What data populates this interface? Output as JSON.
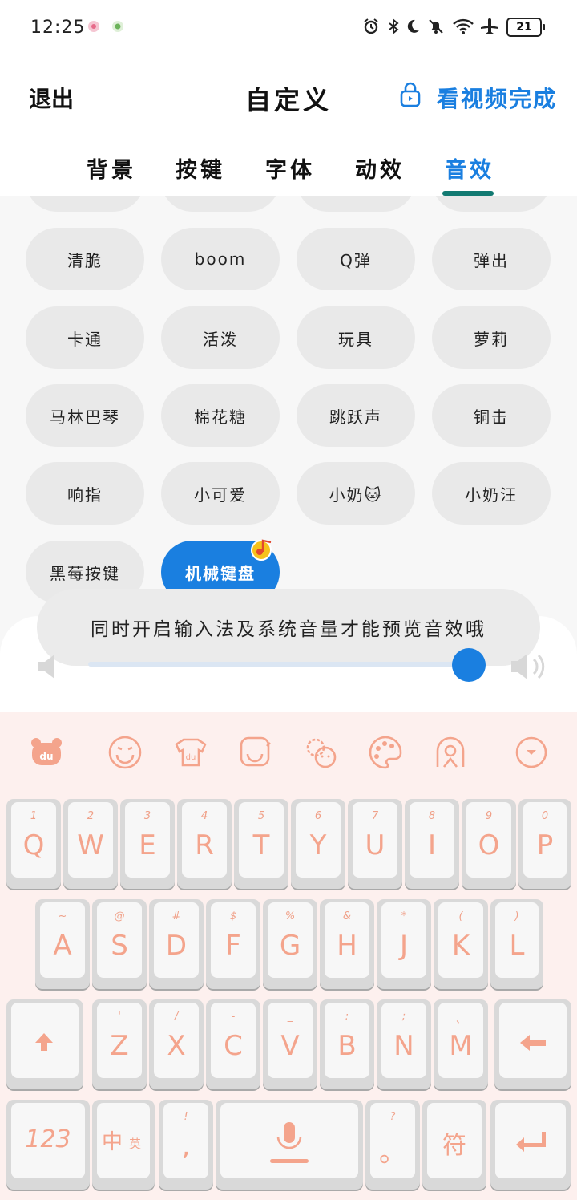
{
  "status_bar": {
    "time": "12:25",
    "battery": "21",
    "icons": [
      "notification-app-icon",
      "wechat-icon",
      "alarm-icon",
      "bluetooth-icon",
      "moon-icon",
      "mute-bell-icon",
      "wifi-icon",
      "airplane-icon"
    ]
  },
  "header": {
    "exit_label": "退出",
    "title": "自定义",
    "action_label": "看视频完成",
    "action_icon": "lock-icon",
    "accent_color": "#1a7fe0"
  },
  "tabs": [
    {
      "label": "背景",
      "active": false
    },
    {
      "label": "按键",
      "active": false
    },
    {
      "label": "字体",
      "active": false
    },
    {
      "label": "动效",
      "active": false
    },
    {
      "label": "音效",
      "active": true
    }
  ],
  "sound_effects": [
    {
      "label": "清脆"
    },
    {
      "label": "boom"
    },
    {
      "label": "Q弹"
    },
    {
      "label": "弹出"
    },
    {
      "label": "卡通"
    },
    {
      "label": "活泼"
    },
    {
      "label": "玩具"
    },
    {
      "label": "萝莉"
    },
    {
      "label": "马林巴琴"
    },
    {
      "label": "棉花糖"
    },
    {
      "label": "跳跃声"
    },
    {
      "label": "铜击"
    },
    {
      "label": "响指"
    },
    {
      "label": "小可爱"
    },
    {
      "label": "小奶🐱"
    },
    {
      "label": "小奶汪"
    },
    {
      "label": "黑莓按键"
    },
    {
      "label": "机械键盘",
      "selected": true
    }
  ],
  "toast": "同时开启输入法及系统音量才能预览音效哦",
  "volume": {
    "level": 0.97
  },
  "keyboard": {
    "theme_color": "#f4a48c",
    "toolbar_icons": [
      "bear-logo-icon",
      "emoji-icon",
      "skin-shirt-icon",
      "sticker-icon",
      "settings-face-icon",
      "palette-icon",
      "keyboard-style-icon",
      "collapse-icon"
    ],
    "row1": [
      {
        "main": "Q",
        "sub": "1"
      },
      {
        "main": "W",
        "sub": "2"
      },
      {
        "main": "E",
        "sub": "3"
      },
      {
        "main": "R",
        "sub": "4"
      },
      {
        "main": "T",
        "sub": "5"
      },
      {
        "main": "Y",
        "sub": "6"
      },
      {
        "main": "U",
        "sub": "7"
      },
      {
        "main": "I",
        "sub": "8"
      },
      {
        "main": "O",
        "sub": "9"
      },
      {
        "main": "P",
        "sub": "0"
      }
    ],
    "row2": [
      {
        "main": "A",
        "sub": "~"
      },
      {
        "main": "S",
        "sub": "@"
      },
      {
        "main": "D",
        "sub": "#"
      },
      {
        "main": "F",
        "sub": "$"
      },
      {
        "main": "G",
        "sub": "%"
      },
      {
        "main": "H",
        "sub": "&"
      },
      {
        "main": "J",
        "sub": "*"
      },
      {
        "main": "K",
        "sub": "("
      },
      {
        "main": "L",
        "sub": ")"
      }
    ],
    "row3": [
      {
        "main": "Z",
        "sub": "'"
      },
      {
        "main": "X",
        "sub": "/"
      },
      {
        "main": "C",
        "sub": "-"
      },
      {
        "main": "V",
        "sub": "_"
      },
      {
        "main": "B",
        "sub": ":"
      },
      {
        "main": "N",
        "sub": ";"
      },
      {
        "main": "M",
        "sub": "、"
      }
    ],
    "row4": {
      "num_label": "123",
      "lang_label": "中",
      "lang_sub": "英",
      "punct_main": ",",
      "punct_sub": "!",
      "period_main": "。",
      "period_sub": "?",
      "symbol_label": "符"
    }
  }
}
